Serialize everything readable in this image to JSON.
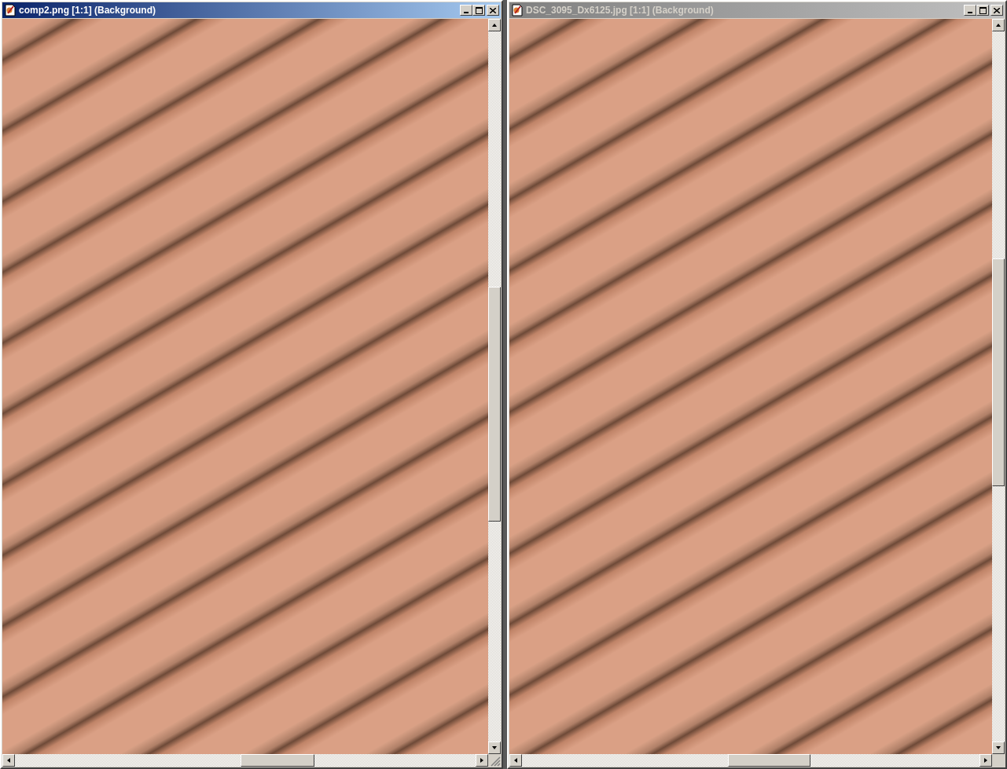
{
  "windows": [
    {
      "title": "comp2.png [1:1] (Background)",
      "active": true
    },
    {
      "title": "DSC_3095_Dx6125.jpg [1:1] (Background)",
      "active": false
    }
  ]
}
